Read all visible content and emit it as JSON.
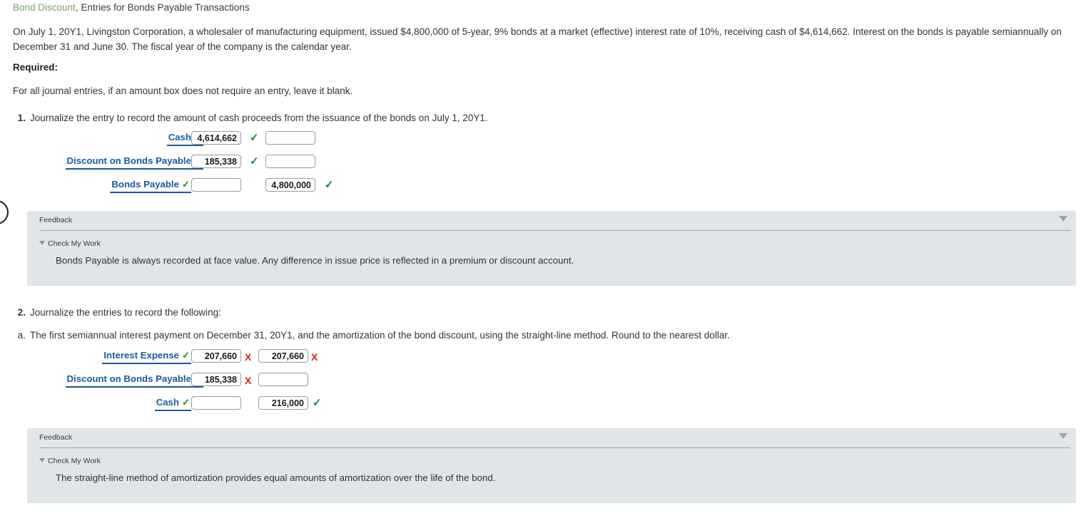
{
  "header": {
    "title_emphasis": "Bond Discount",
    "title_rest": ", Entries for Bonds Payable Transactions"
  },
  "intro": {
    "paragraph": "On July 1, 20Y1, Livingston Corporation, a wholesaler of manufacturing equipment, issued $4,800,000 of 5-year, 9% bonds at a market (effective) interest rate of 10%, receiving cash of $4,614,662. Interest on the bonds is payable semiannually on December 31 and June 30. The fiscal year of the company is the calendar year.",
    "required_label": "Required:",
    "blank_note": "For all journal entries, if an amount box does not require an entry, leave it blank."
  },
  "requirements": {
    "one": {
      "number": "1.",
      "text": "Journalize the entry to record the amount of cash proceeds from the issuance of the bonds on July 1, 20Y1."
    },
    "two": {
      "number": "2.",
      "text": "Journalize the entries to record the following:"
    },
    "two_a": {
      "number": "a.",
      "text": "The first semiannual interest payment on December 31, 20Y1, and the amortization of the bond discount, using the straight-line method. Round to the nearest dollar."
    }
  },
  "entry1": {
    "rows": [
      {
        "account": "Cash",
        "account_mark": "check-icon",
        "indent": 0,
        "debit": "4,614,662",
        "debit_mark": "check-icon",
        "credit": "",
        "credit_mark": ""
      },
      {
        "account": "Discount on Bonds Payable",
        "account_mark": "check-icon",
        "indent": 0,
        "debit": "185,338",
        "debit_mark": "check-icon",
        "credit": "",
        "credit_mark": ""
      },
      {
        "account": "Bonds Payable",
        "account_mark": "check-icon",
        "indent": 1,
        "debit": "",
        "debit_mark": "",
        "credit": "4,800,000",
        "credit_mark": "check-icon"
      }
    ]
  },
  "entry2": {
    "rows": [
      {
        "account": "Interest Expense",
        "account_mark": "check-icon",
        "indent": 1,
        "debit": "207,660",
        "debit_mark": "cross-icon",
        "credit": "207,660",
        "credit_mark": "cross-icon"
      },
      {
        "account": "Discount on Bonds Payable",
        "account_mark": "check-icon",
        "indent": 0,
        "debit": "185,338",
        "debit_mark": "cross-icon",
        "credit": "",
        "credit_mark": ""
      },
      {
        "account": "Cash",
        "account_mark": "check-icon",
        "indent": 1,
        "debit": "",
        "debit_mark": "",
        "credit": "216,000",
        "credit_mark": "check-icon"
      }
    ]
  },
  "feedback1": {
    "title": "Feedback",
    "check_my_work": "Check My Work",
    "body": "Bonds Payable is always recorded at face value. Any difference in issue price is reflected in a premium or discount account."
  },
  "feedback2": {
    "title": "Feedback",
    "check_my_work": "Check My Work",
    "body": "The straight-line method of amortization provides equal amounts of amortization over the life of the bond."
  },
  "glyphs": {
    "check": "✓",
    "cross": "✘"
  },
  "colors": {
    "account_link": "#18599c",
    "correct": "#14892c",
    "incorrect": "#d41f1f",
    "feedback_bg": "#dfe5e8",
    "title_emphasis": "#7fa06b"
  }
}
